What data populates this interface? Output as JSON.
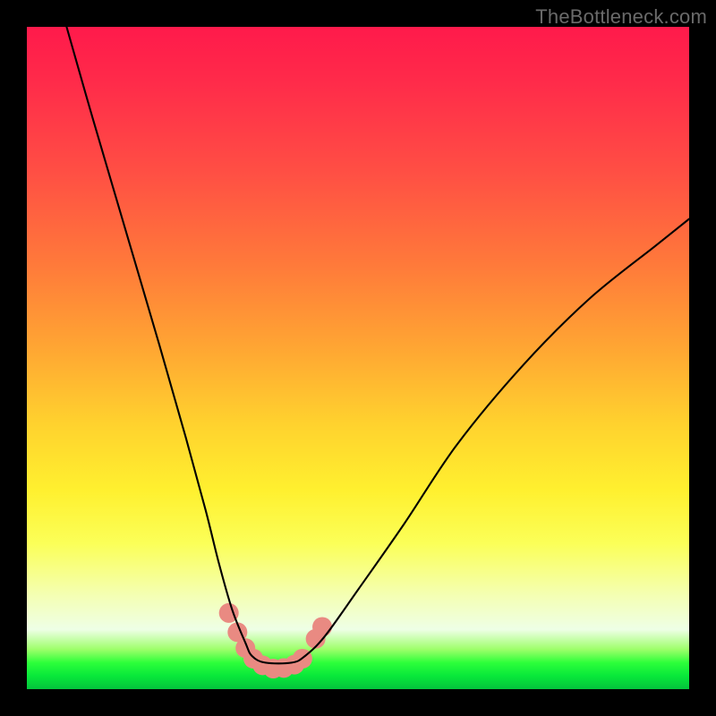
{
  "watermark": "TheBottleneck.com",
  "chart_data": {
    "type": "line",
    "title": "",
    "xlabel": "",
    "ylabel": "",
    "xlim": [
      0,
      100
    ],
    "ylim": [
      0,
      100
    ],
    "series": [
      {
        "name": "curve",
        "x": [
          6,
          10,
          15,
          20,
          24,
          27,
          29,
          31,
          33,
          34,
          36,
          40,
          42,
          45,
          50,
          57,
          65,
          75,
          85,
          95,
          100
        ],
        "y": [
          100,
          86,
          69,
          52,
          38,
          27,
          19,
          12,
          7,
          5,
          4,
          4,
          5,
          8,
          15,
          25,
          37,
          49,
          59,
          67,
          71
        ]
      }
    ],
    "markers": [
      {
        "name": "marker",
        "x": 30.5,
        "y": 11.5
      },
      {
        "name": "marker",
        "x": 31.8,
        "y": 8.6
      },
      {
        "name": "marker",
        "x": 33.0,
        "y": 6.2
      },
      {
        "name": "marker",
        "x": 34.2,
        "y": 4.6
      },
      {
        "name": "marker",
        "x": 35.6,
        "y": 3.6
      },
      {
        "name": "marker",
        "x": 37.2,
        "y": 3.1
      },
      {
        "name": "marker",
        "x": 38.8,
        "y": 3.2
      },
      {
        "name": "marker",
        "x": 40.4,
        "y": 3.7
      },
      {
        "name": "marker",
        "x": 41.6,
        "y": 4.6
      },
      {
        "name": "marker",
        "x": 43.6,
        "y": 7.6
      },
      {
        "name": "marker",
        "x": 44.6,
        "y": 9.4
      }
    ],
    "style": {
      "curve_stroke": "#000000",
      "curve_width": 2.1,
      "marker_fill": "#e98a82",
      "marker_radius": 11
    }
  }
}
